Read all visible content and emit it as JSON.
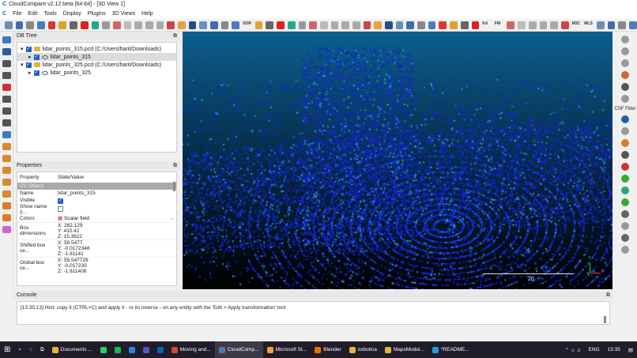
{
  "window": {
    "title": "CloudCompare v2.12 beta [64-bit] - [3D View 1]"
  },
  "menu": [
    "File",
    "Edit",
    "Tools",
    "Display",
    "Plugins",
    "3D Views",
    "Help"
  ],
  "toolbar": {
    "labels": [
      "SOR",
      "Kd",
      "FM",
      "M3C",
      "MLS"
    ]
  },
  "db_tree": {
    "title": "DB Tree",
    "items": [
      {
        "label": "lidar_points_315.pcd (C:/Users/harit/Downloads)",
        "level": 0
      },
      {
        "label": "lidar_points_315",
        "level": 1,
        "selected": true
      },
      {
        "label": "lidar_points_325.pcd (C:/Users/harit/Downloads)",
        "level": 0
      },
      {
        "label": "lidar_points_325",
        "level": 1
      }
    ]
  },
  "properties": {
    "title": "Properties",
    "col_property": "Property",
    "col_value": "State/Value",
    "group": "CC Object",
    "rows": [
      {
        "name": "Name",
        "value": "lidar_points_315"
      },
      {
        "name": "Visible",
        "checked": true
      },
      {
        "name": "Show name (i...",
        "checked": false
      },
      {
        "name": "Colors",
        "value": "Scalar field"
      },
      {
        "name": "Box dimensions",
        "lines": [
          "X: 282.129",
          "Y: 410.42",
          "Z: 15.3622"
        ]
      },
      {
        "name": "Shifted box ce...",
        "lines": [
          "X: 59.5477",
          "Y: -0.0172348",
          "Z: -1.61141"
        ]
      },
      {
        "name": "Global box ce...",
        "lines": [
          "X: 59.547729",
          "Y: -0.017235",
          "Z: -1.611408"
        ]
      }
    ]
  },
  "viewport": {
    "scale_label": "20",
    "axis_x": "X",
    "axis_y": "Y"
  },
  "right_toolbar": {
    "label": "CSF Filter"
  },
  "console": {
    "title": "Console",
    "line": "[13:35:13] Hint: copy it (CTRL+C) and apply it - or its inverse - on any entity with the 'Edit > Apply transformation' tool"
  },
  "taskbar": {
    "apps": [
      {
        "label": "Documents ...",
        "color": "#e6b33c"
      },
      {
        "label": "Moving and...",
        "color": "#db4437"
      },
      {
        "label": "CloudComp...",
        "color": "#4a7ab5",
        "active": true
      },
      {
        "label": "Microsoft St...",
        "color": "#e8a33c"
      },
      {
        "label": "Blender",
        "color": "#ea7600"
      },
      {
        "label": "oxbotica",
        "color": "#e6b33c"
      },
      {
        "label": "MapsModel...",
        "color": "#e6b33c"
      },
      {
        "label": "*README...",
        "color": "#2b9ad8"
      }
    ],
    "lang": "ENG",
    "time": "13:35"
  }
}
